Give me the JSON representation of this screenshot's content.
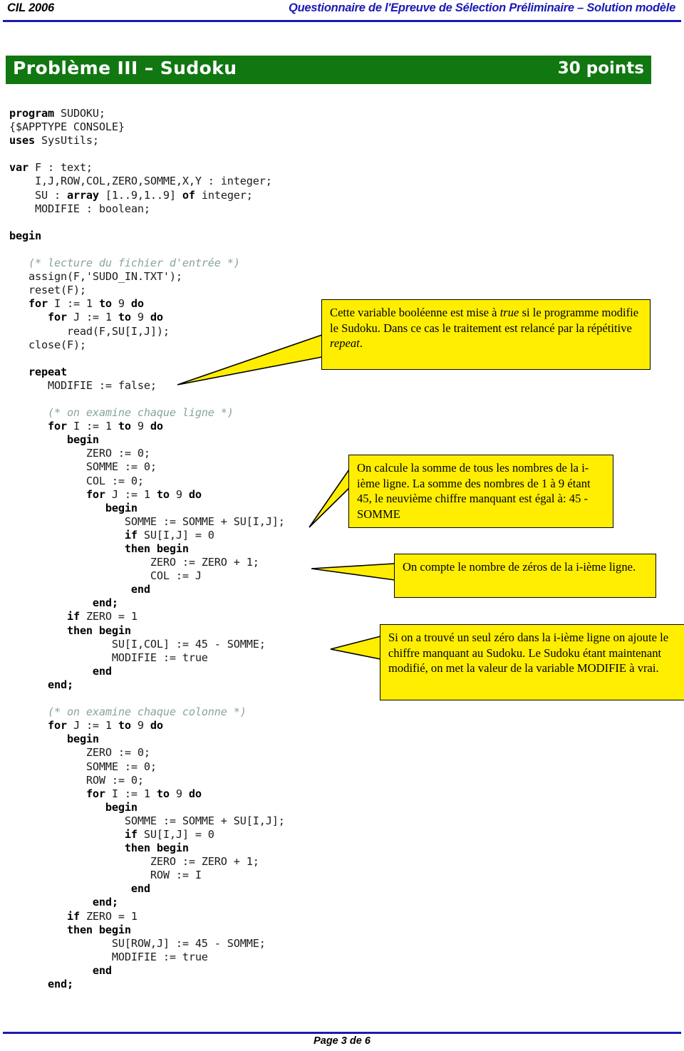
{
  "header": {
    "left": "CIL 2006",
    "right": "Questionnaire de l'Epreuve de Sélection Préliminaire – Solution modèle",
    "rule_color": "#1a1ab5"
  },
  "title_banner": {
    "title": "Problème III – Sudoku",
    "points": "30 points",
    "background_color": "#117711",
    "text_color": "#ffffff"
  },
  "code": {
    "language": "Pascal",
    "comment_color": "#87a598",
    "lines": [
      {
        "segments": [
          {
            "t": "program ",
            "s": "kw"
          },
          {
            "t": "SUDOKU;",
            "s": ""
          }
        ]
      },
      {
        "segments": [
          {
            "t": "{$APPTYPE CONSOLE}",
            "s": ""
          }
        ]
      },
      {
        "segments": [
          {
            "t": "uses ",
            "s": "kw"
          },
          {
            "t": "SysUtils;",
            "s": ""
          }
        ]
      },
      {
        "segments": []
      },
      {
        "segments": [
          {
            "t": "var ",
            "s": "kw"
          },
          {
            "t": "F : text;",
            "s": ""
          }
        ]
      },
      {
        "segments": [
          {
            "t": "    I,J,ROW,COL,ZERO,SOMME,X,Y : integer;",
            "s": ""
          }
        ]
      },
      {
        "segments": [
          {
            "t": "    SU : ",
            "s": ""
          },
          {
            "t": "array ",
            "s": "kw"
          },
          {
            "t": "[1..9,1..9] ",
            "s": ""
          },
          {
            "t": "of ",
            "s": "kw"
          },
          {
            "t": "integer;",
            "s": ""
          }
        ]
      },
      {
        "segments": [
          {
            "t": "    MODIFIE : boolean;",
            "s": ""
          }
        ]
      },
      {
        "segments": []
      },
      {
        "segments": [
          {
            "t": "begin",
            "s": "kw"
          }
        ]
      },
      {
        "segments": []
      },
      {
        "segments": [
          {
            "t": "   (* lecture du fichier d'entrée *)",
            "s": "cm"
          }
        ]
      },
      {
        "segments": [
          {
            "t": "   assign(F,'SUDO_IN.TXT');",
            "s": ""
          }
        ]
      },
      {
        "segments": [
          {
            "t": "   reset(F);",
            "s": ""
          }
        ]
      },
      {
        "segments": [
          {
            "t": "   ",
            "s": ""
          },
          {
            "t": "for ",
            "s": "kw"
          },
          {
            "t": "I := 1 ",
            "s": ""
          },
          {
            "t": "to ",
            "s": "kw"
          },
          {
            "t": "9 ",
            "s": ""
          },
          {
            "t": "do",
            "s": "kw"
          }
        ]
      },
      {
        "segments": [
          {
            "t": "      ",
            "s": ""
          },
          {
            "t": "for ",
            "s": "kw"
          },
          {
            "t": "J := 1 ",
            "s": ""
          },
          {
            "t": "to ",
            "s": "kw"
          },
          {
            "t": "9 ",
            "s": ""
          },
          {
            "t": "do",
            "s": "kw"
          }
        ]
      },
      {
        "segments": [
          {
            "t": "         read(F,SU[I,J]);",
            "s": ""
          }
        ]
      },
      {
        "segments": [
          {
            "t": "   close(F);",
            "s": ""
          }
        ]
      },
      {
        "segments": []
      },
      {
        "segments": [
          {
            "t": "   ",
            "s": ""
          },
          {
            "t": "repeat",
            "s": "kw"
          }
        ]
      },
      {
        "segments": [
          {
            "t": "      MODIFIE := false;",
            "s": ""
          }
        ]
      },
      {
        "segments": []
      },
      {
        "segments": [
          {
            "t": "      (* on examine chaque ligne *)",
            "s": "cm"
          }
        ]
      },
      {
        "segments": [
          {
            "t": "      ",
            "s": ""
          },
          {
            "t": "for ",
            "s": "kw"
          },
          {
            "t": "I := 1 ",
            "s": ""
          },
          {
            "t": "to ",
            "s": "kw"
          },
          {
            "t": "9 ",
            "s": ""
          },
          {
            "t": "do",
            "s": "kw"
          }
        ]
      },
      {
        "segments": [
          {
            "t": "         ",
            "s": ""
          },
          {
            "t": "begin",
            "s": "kw"
          }
        ]
      },
      {
        "segments": [
          {
            "t": "            ZERO := 0;",
            "s": ""
          }
        ]
      },
      {
        "segments": [
          {
            "t": "            SOMME := 0;",
            "s": ""
          }
        ]
      },
      {
        "segments": [
          {
            "t": "            COL := 0;",
            "s": ""
          }
        ]
      },
      {
        "segments": [
          {
            "t": "            ",
            "s": ""
          },
          {
            "t": "for ",
            "s": "kw"
          },
          {
            "t": "J := 1 ",
            "s": ""
          },
          {
            "t": "to ",
            "s": "kw"
          },
          {
            "t": "9 ",
            "s": ""
          },
          {
            "t": "do",
            "s": "kw"
          }
        ]
      },
      {
        "segments": [
          {
            "t": "               ",
            "s": ""
          },
          {
            "t": "begin",
            "s": "kw"
          }
        ]
      },
      {
        "segments": [
          {
            "t": "                  SOMME := SOMME + SU[I,J];",
            "s": ""
          }
        ]
      },
      {
        "segments": [
          {
            "t": "                  ",
            "s": ""
          },
          {
            "t": "if ",
            "s": "kw"
          },
          {
            "t": "SU[I,J] = 0",
            "s": ""
          }
        ]
      },
      {
        "segments": [
          {
            "t": "                  ",
            "s": ""
          },
          {
            "t": "then begin",
            "s": "kw"
          }
        ]
      },
      {
        "segments": [
          {
            "t": "                      ZERO := ZERO + 1;",
            "s": ""
          }
        ]
      },
      {
        "segments": [
          {
            "t": "                      COL := J",
            "s": ""
          }
        ]
      },
      {
        "segments": [
          {
            "t": "                   ",
            "s": ""
          },
          {
            "t": "end",
            "s": "kw"
          }
        ]
      },
      {
        "segments": [
          {
            "t": "             ",
            "s": ""
          },
          {
            "t": "end;",
            "s": "kw"
          }
        ]
      },
      {
        "segments": [
          {
            "t": "         ",
            "s": ""
          },
          {
            "t": "if ",
            "s": "kw"
          },
          {
            "t": "ZERO = 1",
            "s": ""
          }
        ]
      },
      {
        "segments": [
          {
            "t": "         ",
            "s": ""
          },
          {
            "t": "then begin",
            "s": "kw"
          }
        ]
      },
      {
        "segments": [
          {
            "t": "                SU[I,COL] := 45 - SOMME;",
            "s": ""
          }
        ]
      },
      {
        "segments": [
          {
            "t": "                MODIFIE := true",
            "s": ""
          }
        ]
      },
      {
        "segments": [
          {
            "t": "             ",
            "s": ""
          },
          {
            "t": "end",
            "s": "kw"
          }
        ]
      },
      {
        "segments": [
          {
            "t": "      ",
            "s": ""
          },
          {
            "t": "end;",
            "s": "kw"
          }
        ]
      },
      {
        "segments": []
      },
      {
        "segments": [
          {
            "t": "      (* on examine chaque colonne *)",
            "s": "cm"
          }
        ]
      },
      {
        "segments": [
          {
            "t": "      ",
            "s": ""
          },
          {
            "t": "for ",
            "s": "kw"
          },
          {
            "t": "J := 1 ",
            "s": ""
          },
          {
            "t": "to ",
            "s": "kw"
          },
          {
            "t": "9 ",
            "s": ""
          },
          {
            "t": "do",
            "s": "kw"
          }
        ]
      },
      {
        "segments": [
          {
            "t": "         ",
            "s": ""
          },
          {
            "t": "begin",
            "s": "kw"
          }
        ]
      },
      {
        "segments": [
          {
            "t": "            ZERO := 0;",
            "s": ""
          }
        ]
      },
      {
        "segments": [
          {
            "t": "            SOMME := 0;",
            "s": ""
          }
        ]
      },
      {
        "segments": [
          {
            "t": "            ROW := 0;",
            "s": ""
          }
        ]
      },
      {
        "segments": [
          {
            "t": "            ",
            "s": ""
          },
          {
            "t": "for ",
            "s": "kw"
          },
          {
            "t": "I := 1 ",
            "s": ""
          },
          {
            "t": "to ",
            "s": "kw"
          },
          {
            "t": "9 ",
            "s": ""
          },
          {
            "t": "do",
            "s": "kw"
          }
        ]
      },
      {
        "segments": [
          {
            "t": "               ",
            "s": ""
          },
          {
            "t": "begin",
            "s": "kw"
          }
        ]
      },
      {
        "segments": [
          {
            "t": "                  SOMME := SOMME + SU[I,J];",
            "s": ""
          }
        ]
      },
      {
        "segments": [
          {
            "t": "                  ",
            "s": ""
          },
          {
            "t": "if ",
            "s": "kw"
          },
          {
            "t": "SU[I,J] = 0",
            "s": ""
          }
        ]
      },
      {
        "segments": [
          {
            "t": "                  ",
            "s": ""
          },
          {
            "t": "then begin",
            "s": "kw"
          }
        ]
      },
      {
        "segments": [
          {
            "t": "                      ZERO := ZERO + 1;",
            "s": ""
          }
        ]
      },
      {
        "segments": [
          {
            "t": "                      ROW := I",
            "s": ""
          }
        ]
      },
      {
        "segments": [
          {
            "t": "                   ",
            "s": ""
          },
          {
            "t": "end",
            "s": "kw"
          }
        ]
      },
      {
        "segments": [
          {
            "t": "             ",
            "s": ""
          },
          {
            "t": "end;",
            "s": "kw"
          }
        ]
      },
      {
        "segments": [
          {
            "t": "         ",
            "s": ""
          },
          {
            "t": "if ",
            "s": "kw"
          },
          {
            "t": "ZERO = 1",
            "s": ""
          }
        ]
      },
      {
        "segments": [
          {
            "t": "         ",
            "s": ""
          },
          {
            "t": "then begin",
            "s": "kw"
          }
        ]
      },
      {
        "segments": [
          {
            "t": "                SU[ROW,J] := 45 - SOMME;",
            "s": ""
          }
        ]
      },
      {
        "segments": [
          {
            "t": "                MODIFIE := true",
            "s": ""
          }
        ]
      },
      {
        "segments": [
          {
            "t": "             ",
            "s": ""
          },
          {
            "t": "end",
            "s": "kw"
          }
        ]
      },
      {
        "segments": [
          {
            "t": "      ",
            "s": ""
          },
          {
            "t": "end;",
            "s": "kw"
          }
        ]
      }
    ]
  },
  "callouts": [
    {
      "id": "callout-1",
      "background_color": "#ffee00",
      "parts": [
        {
          "t": "Cette variable booléenne est mise à ",
          "i": false
        },
        {
          "t": "true",
          "i": true
        },
        {
          "t": " si le programme modifie le Sudoku. Dans ce cas le traitement est relancé par la répétitive ",
          "i": false
        },
        {
          "t": "repeat",
          "i": true
        },
        {
          "t": ".",
          "i": false
        }
      ]
    },
    {
      "id": "callout-2",
      "background_color": "#ffee00",
      "parts": [
        {
          "t": "On calcule la somme de tous les nombres de la i-ième ligne. La somme des nombres de 1 à 9 étant 45, le neuvième chiffre manquant est égal à:  45 - SOMME",
          "i": false
        }
      ]
    },
    {
      "id": "callout-3",
      "background_color": "#ffee00",
      "parts": [
        {
          "t": "On compte le nombre de zéros de la i-ième ligne.",
          "i": false
        }
      ]
    },
    {
      "id": "callout-4",
      "background_color": "#ffee00",
      "parts": [
        {
          "t": "Si on a trouvé un seul zéro dans la i-ième ligne on ajoute le chiffre manquant au Sudoku. Le Sudoku étant maintenant modifié, on met la valeur de la variable MODIFIE à vrai.",
          "i": false
        }
      ]
    }
  ],
  "footer": {
    "page_label": "Page 3 de 6",
    "rule_color": "#1a1ab5"
  }
}
